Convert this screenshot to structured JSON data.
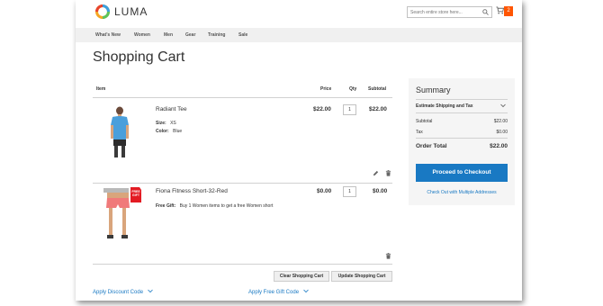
{
  "header": {
    "logo_text": "LUMA",
    "search_placeholder": "Search entire store here...",
    "cart_count": "2"
  },
  "nav": {
    "items": [
      "What's New",
      "Women",
      "Men",
      "Gear",
      "Training",
      "Sale"
    ]
  },
  "page_title": "Shopping Cart",
  "table": {
    "headers": {
      "item": "Item",
      "price": "Price",
      "qty": "Qty",
      "subtotal": "Subtotal"
    },
    "rows": [
      {
        "name": "Radiant Tee",
        "options": [
          {
            "label": "Size:",
            "value": "XS"
          },
          {
            "label": "Color:",
            "value": "Blue"
          }
        ],
        "price": "$22.00",
        "qty": "1",
        "subtotal": "$22.00"
      },
      {
        "name": "Fiona Fitness Short-32-Red",
        "badge": "FREE GIFT",
        "options": [
          {
            "label": "Free Gift:",
            "value": "Buy 1 Women items to get a free Women short"
          }
        ],
        "price": "$0.00",
        "qty": "1",
        "subtotal": "$0.00"
      }
    ]
  },
  "actions": {
    "clear": "Clear Shopping Cart",
    "update": "Update Shopping Cart"
  },
  "links": {
    "discount": "Apply Discount Code",
    "gift": "Apply Free Gift Code"
  },
  "summary": {
    "title": "Summary",
    "estimate": "Estimate Shipping and Tax",
    "subtotal_label": "Subtotal",
    "subtotal_value": "$22.00",
    "tax_label": "Tax",
    "tax_value": "$0.00",
    "total_label": "Order Total",
    "total_value": "$22.00",
    "checkout": "Proceed to Checkout",
    "multi": "Check Out with Multiple Addresses"
  },
  "colors": {
    "accent": "#1979c3",
    "badge": "#ff5501"
  },
  "icons": [
    "luma-logo-icon",
    "search-icon",
    "cart-icon",
    "pencil-icon",
    "trash-icon",
    "chevron-down-icon"
  ]
}
